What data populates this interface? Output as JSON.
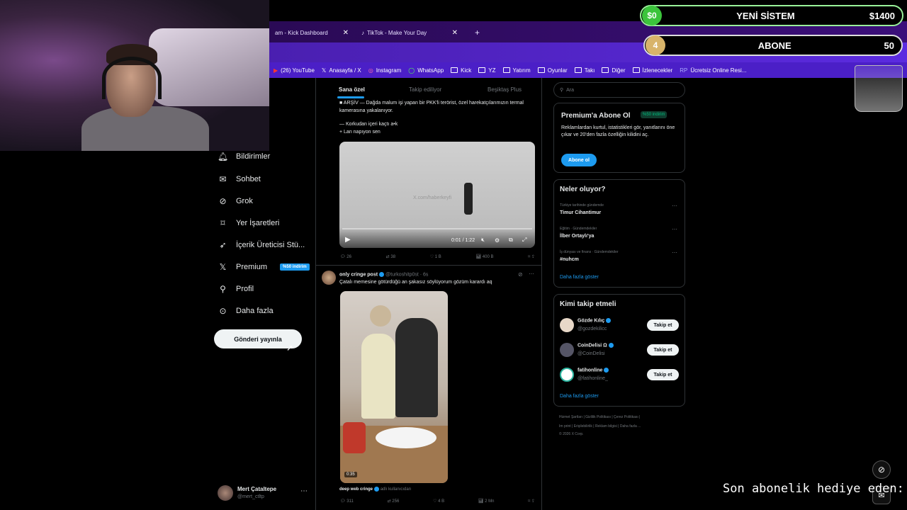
{
  "overlay": {
    "goal_pill": {
      "left_value": "$0",
      "title": "YENİ SİSTEM",
      "right_value": "$1400"
    },
    "sub_pill": {
      "left_value": "4",
      "title": "ABONE",
      "right_value": "50"
    },
    "ticker_text": "Son abonelik hediye eden:"
  },
  "browser": {
    "tabs": [
      {
        "label": "am - Kick Dashboard"
      },
      {
        "label": "TikTok - Make Your Day"
      }
    ],
    "new_tab": "+",
    "bookmarks": [
      "(26) YouTube",
      "Anasayfa / X",
      "Instagram",
      "WhatsApp",
      "Kick",
      "YZ",
      "Yatırım",
      "Oyunlar",
      "Takı",
      "Diğer",
      "İzlenecekler",
      "Ücretsiz Online Resi..."
    ]
  },
  "nav": {
    "items": [
      {
        "label": "Bildirimler",
        "icon": "bell-icon"
      },
      {
        "label": "Sohbet",
        "icon": "mail-icon"
      },
      {
        "label": "Grok",
        "icon": "grok-icon"
      },
      {
        "label": "Yer İşaretleri",
        "icon": "bookmark-icon"
      },
      {
        "label": "İçerik Üreticisi Stü...",
        "icon": "rocket-icon"
      },
      {
        "label": "Premium",
        "icon": "x-logo-icon",
        "badge": "%50 indirim"
      },
      {
        "label": "Profil",
        "icon": "person-icon"
      },
      {
        "label": "Daha fazla",
        "icon": "more-circle-icon"
      }
    ],
    "post_button": "Gönderi yayınla",
    "account": {
      "name": "Mert Çataltepe",
      "handle": "@mert_ctltp"
    }
  },
  "feed": {
    "tabs": [
      "Sana özel",
      "Takip ediliyor",
      "Beşiktaş Plus"
    ],
    "post1": {
      "text1": "■ ARŞİV — Dağda malum işi yapan bir PKK'li terörist, özel harekatçılarımızın termal kamerasına yakalanıyor.",
      "text2": "— Korkudan içeri kaçtı a•k",
      "text3": "+ Lan napıyon sen",
      "video_time": "0:01 / 1:22",
      "watermark": "X.com/haberkeyfi",
      "replies": "26",
      "reposts": "38",
      "likes": "1 B",
      "views": "400 B"
    },
    "post2": {
      "author": "only cringe post",
      "handle": "@turkoshitp0st · 6s",
      "text": "Çatalı memesine götürdüğü an şakasız söylüyorum gözüm karardı aq",
      "duration": "0:35",
      "source_name": "deep web cringe",
      "source_suffix": "adlı kullanıcıdan",
      "replies": "311",
      "reposts": "256",
      "likes": "4 B",
      "views": "2 Mn"
    }
  },
  "right": {
    "search_placeholder": "Ara",
    "premium": {
      "title": "Premium'a Abone Ol",
      "badge": "%50 indirim",
      "body": "Reklamlardan kurtul, istatistikleri gör, yanıtlarını öne çıkar ve 20'den fazla özelliğin kilidini aç.",
      "button": "Abone ol"
    },
    "trends": {
      "title": "Neler oluyor?",
      "items": [
        {
          "context": "Türkiye tarihinde gündemde",
          "name": "Timur Cihantimur"
        },
        {
          "context": "Eğitim · Gündemdekiler",
          "name": "İlber Ortaylı'ya"
        },
        {
          "context": "İş dünyası ve finans · Gündemdekiler",
          "name": "#nuhcm"
        }
      ],
      "more": "Daha fazla göster"
    },
    "follow": {
      "title": "Kimi takip etmeli",
      "items": [
        {
          "name": "Gözde Kılıç",
          "handle": "@gozdekilicc"
        },
        {
          "name": "CoinDelisi Ω",
          "handle": "@CoinDelisi"
        },
        {
          "name": "fatihonline",
          "handle": "@fatihonline_"
        }
      ],
      "button": "Takip et",
      "more": "Daha fazla göster"
    },
    "footer": {
      "line1": "Hizmet Şartları | Gizlilik Politikası | Çerez Politikası |",
      "line2": "Im print | Erişilebilirlik | Reklam bilgisi | Daha fazla ...",
      "line3": "© 2026 X Corp."
    }
  }
}
